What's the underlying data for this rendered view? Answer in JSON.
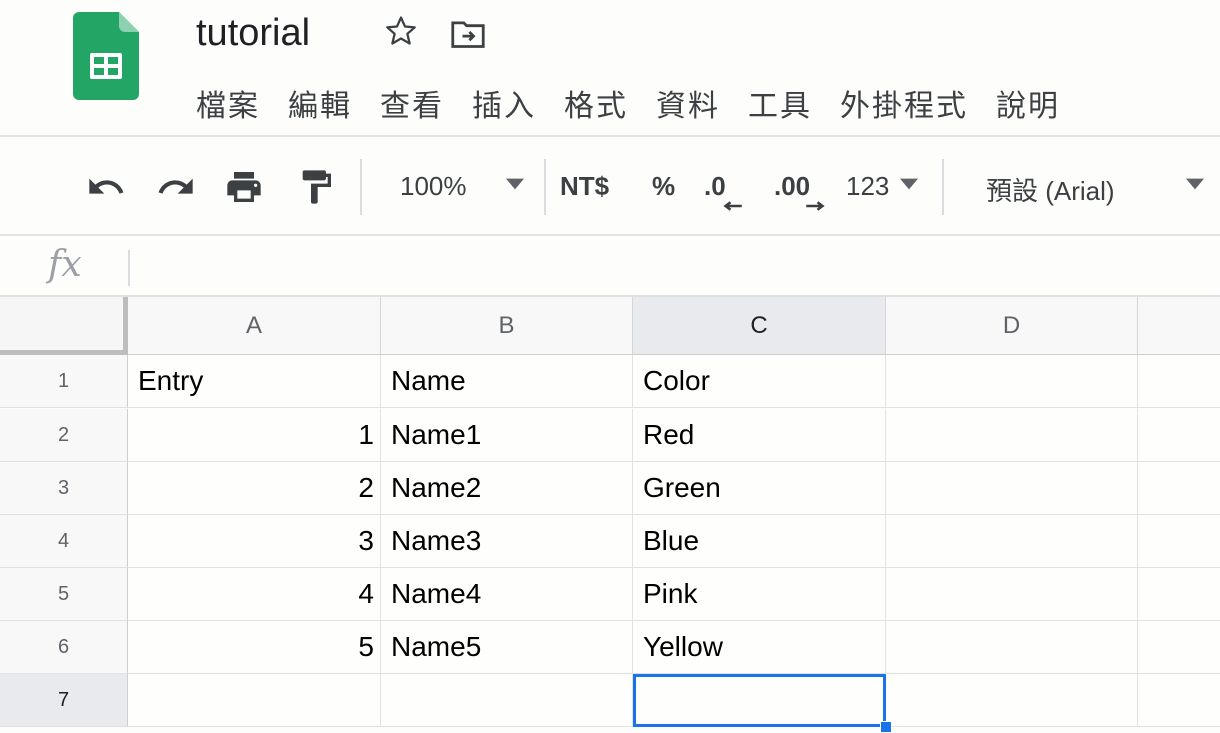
{
  "app": {
    "title": "tutorial",
    "menu": [
      "檔案",
      "編輯",
      "查看",
      "插入",
      "格式",
      "資料",
      "工具",
      "外掛程式",
      "說明"
    ],
    "logo_icon": "google-sheets-logo-icon",
    "star_icon": "star-outline-icon",
    "move_icon": "move-to-folder-icon"
  },
  "toolbar": {
    "undo_icon": "undo-icon",
    "redo_icon": "redo-icon",
    "print_icon": "print-icon",
    "paint_format_icon": "paint-format-icon",
    "zoom": "100%",
    "currency": "NT$",
    "percent": "%",
    "decrease_decimal": ".0",
    "increase_decimal": ".00",
    "more_formats": "123",
    "font": "預設 (Arial)"
  },
  "formula_bar": {
    "label": "fx",
    "value": ""
  },
  "grid": {
    "columns": [
      "A",
      "B",
      "C",
      "D"
    ],
    "selected_column": "C",
    "row_numbers": [
      "1",
      "2",
      "3",
      "4",
      "5",
      "6",
      "7"
    ],
    "selected_row": "7",
    "rows": [
      [
        "Entry",
        "Name",
        "Color",
        ""
      ],
      [
        "1",
        "Name1",
        "Red",
        ""
      ],
      [
        "2",
        "Name2",
        "Green",
        ""
      ],
      [
        "3",
        "Name3",
        "Blue",
        ""
      ],
      [
        "4",
        "Name4",
        "Pink",
        ""
      ],
      [
        "5",
        "Name5",
        "Yellow",
        ""
      ],
      [
        "",
        "",
        "",
        ""
      ]
    ],
    "active_cell": "C7"
  },
  "colors": {
    "sheets_green": "#23a566",
    "selection_blue": "#1a73e8",
    "header_gray": "#f8f8f8"
  }
}
